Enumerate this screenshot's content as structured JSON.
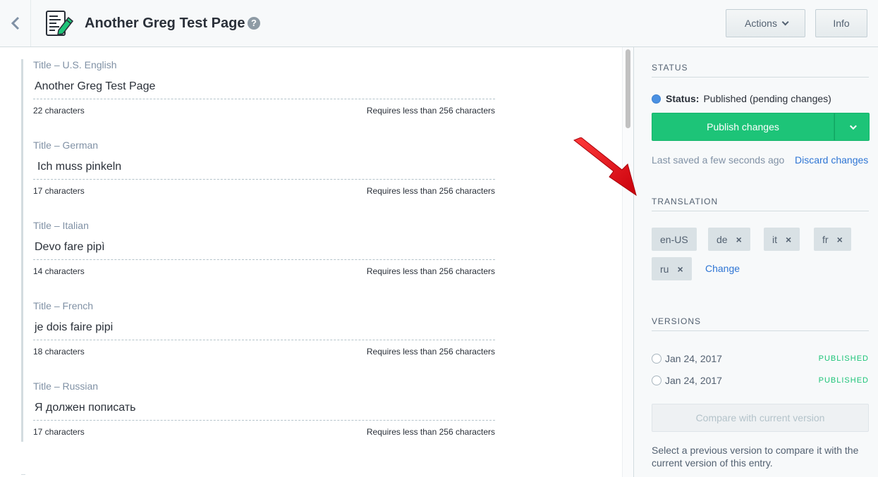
{
  "header": {
    "title": "Another Greg Test Page",
    "help_icon": "?",
    "actions_label": "Actions",
    "info_label": "Info"
  },
  "fields": [
    {
      "label": "Title – U.S. English",
      "value": "Another Greg Test Page",
      "count": "22 characters",
      "requirement": "Requires less than 256 characters"
    },
    {
      "label": "Title – German",
      "value": "Ich muss pinkeln",
      "count": "17 characters",
      "requirement": "Requires less than 256 characters"
    },
    {
      "label": "Title – Italian",
      "value": "Devo fare pipì",
      "count": "14 characters",
      "requirement": "Requires less than 256 characters"
    },
    {
      "label": "Title – French",
      "value": "je dois faire pipi",
      "count": "18 characters",
      "requirement": "Requires less than 256 characters"
    },
    {
      "label": "Title – Russian",
      "value": "Я должен пописать",
      "count": "17 characters",
      "requirement": "Requires less than 256 characters"
    }
  ],
  "sidebar": {
    "status": {
      "heading": "STATUS",
      "key": "Status:",
      "value": "Published (pending changes)",
      "publish_label": "Publish changes",
      "saved_text": "Last saved a few seconds ago",
      "discard_label": "Discard changes"
    },
    "translation": {
      "heading": "TRANSLATION",
      "locales": [
        "en-US",
        "de",
        "it",
        "fr",
        "ru"
      ],
      "remove_icon": "×",
      "change_label": "Change"
    },
    "versions": {
      "heading": "VERSIONS",
      "items": [
        {
          "date": "Jan 24, 2017",
          "state": "PUBLISHED"
        },
        {
          "date": "Jan 24, 2017",
          "state": "PUBLISHED"
        }
      ],
      "compare_label": "Compare with current version",
      "hint": "Select a previous version to compare it with the current version of this entry."
    }
  },
  "colors": {
    "publish": "#1dc478",
    "link": "#2e75d4",
    "status_dot": "#4a90e2",
    "annotation_arrow": "#e0141b"
  },
  "icons": {
    "back": "chevron-left-icon",
    "entry": "entry-document-icon",
    "help": "question-icon",
    "dropdown": "chevron-down-icon",
    "remove": "close-icon",
    "annotation": "red-arrow-icon"
  }
}
